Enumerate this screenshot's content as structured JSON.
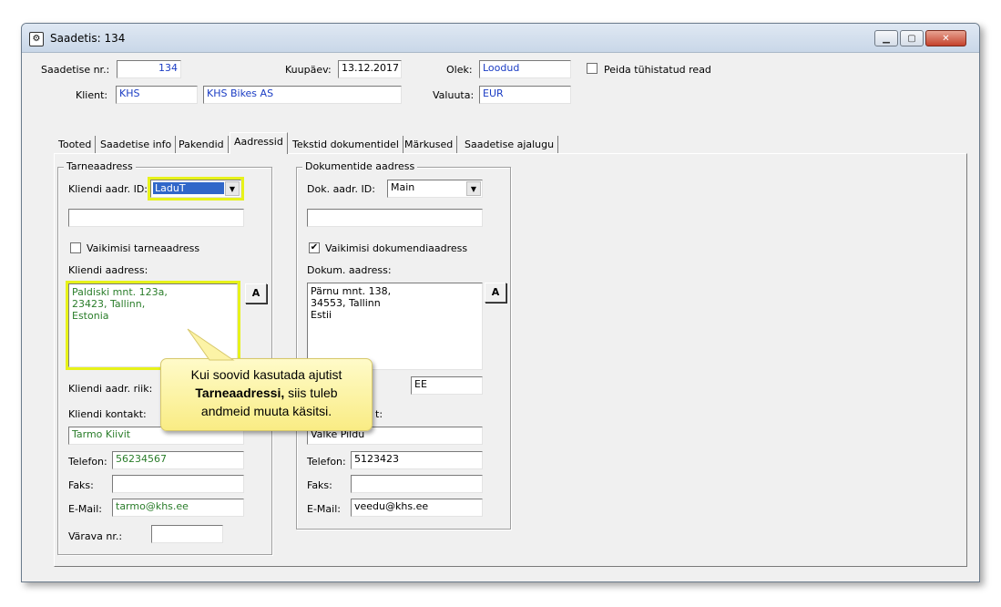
{
  "window": {
    "title": "Saadetis: 134"
  },
  "header": {
    "shipment_no_label": "Saadetise nr.:",
    "shipment_no_value": "134",
    "date_label": "Kuupäev:",
    "date_value": "13.12.2017",
    "status_label": "Olek:",
    "status_value": "Loodud",
    "hide_cancelled_label": "Peida tühistatud read",
    "client_label": "Klient:",
    "client_code": "KHS",
    "client_name": "KHS Bikes AS",
    "currency_label": "Valuuta:",
    "currency_value": "EUR"
  },
  "tabs": [
    {
      "label": "Tooted"
    },
    {
      "label": "Saadetise info"
    },
    {
      "label": "Pakendid"
    },
    {
      "label": "Aadressid"
    },
    {
      "label": "Tekstid dokumentidel"
    },
    {
      "label": "Märkused"
    },
    {
      "label": "Saadetise ajalugu"
    }
  ],
  "delivery": {
    "group_title": "Tarneaadress",
    "addr_id_label": "Kliendi aadr. ID:",
    "addr_id_value": "LaduT",
    "default_label": "Vaikimisi tarneaadress",
    "address_label": "Kliendi aadress:",
    "address_value": "Paldiski mnt. 123a,\n23423, Tallinn,\nEstonia",
    "a_button": "A",
    "country_label": "Kliendi aadr. riik:",
    "contact_label": "Kliendi kontakt:",
    "contact_value": "Tarmo Kiivit",
    "phone_label": "Telefon:",
    "phone_value": "56234567",
    "fax_label": "Faks:",
    "fax_value": "",
    "email_label": "E-Mail:",
    "email_value": "tarmo@khs.ee",
    "gate_label": "Värava nr.:",
    "gate_value": ""
  },
  "documents": {
    "group_title": "Dokumentide aadress",
    "addr_id_label": "Dok. aadr. ID:",
    "addr_id_value": "Main",
    "default_label": "Vaikimisi dokumendiaadress",
    "address_label": "Dokum. aadress:",
    "address_value": "Pärnu mnt. 138,\n34553, Tallinn\nEstii",
    "a_button": "A",
    "country_value": "EE",
    "contact_label": "t:",
    "contact_value": "Valke Pildu",
    "phone_label": "Telefon:",
    "phone_value": "5123423",
    "fax_label": "Faks:",
    "fax_value": "",
    "email_label": "E-Mail:",
    "email_value": "veedu@khs.ee"
  },
  "tooltip": {
    "line1": "Kui soovid kasutada ajutist",
    "line2_bold": "Tarneaadressi,",
    "line2_rest": " siis tuleb",
    "line3": "andmeid muuta käsitsi."
  },
  "colors": {
    "highlight": "#e7f21a",
    "tooltip_bg": "#fbf19a",
    "field_blue": "#1a3cc4",
    "field_green": "#2a7d2a"
  }
}
